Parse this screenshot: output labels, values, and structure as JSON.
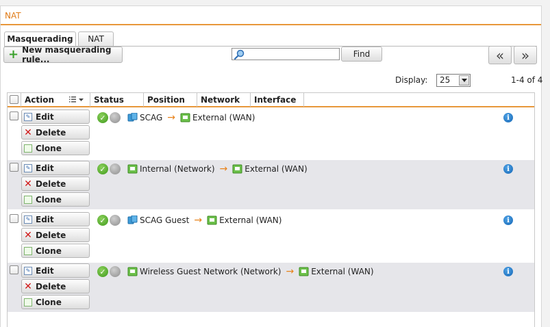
{
  "panel": {
    "title": "NAT"
  },
  "tabs": [
    {
      "label": "Masquerading",
      "active": true
    },
    {
      "label": "NAT",
      "active": false
    }
  ],
  "toolbar": {
    "new_rule_label": "New masquerading rule...",
    "search_value": "",
    "find_label": "Find",
    "prev_label": "«",
    "next_label": "»"
  },
  "display": {
    "label": "Display:",
    "value": "25",
    "count": "1-4 of 4"
  },
  "columns": [
    "Action",
    "Status",
    "Position",
    "Network",
    "Interface"
  ],
  "actions": {
    "edit": "Edit",
    "delete": "Delete",
    "clone": "Clone"
  },
  "rows": [
    {
      "source": "SCAG",
      "source_icon": "network-host-icon",
      "target": "External (WAN)",
      "status": "enabled"
    },
    {
      "source": "Internal (Network)",
      "source_icon": "network-interface-icon",
      "target": "External (WAN)",
      "status": "enabled"
    },
    {
      "source": "SCAG Guest",
      "source_icon": "network-host-icon",
      "target": "External (WAN)",
      "status": "enabled"
    },
    {
      "source": "Wireless Guest Network (Network)",
      "source_icon": "network-interface-icon",
      "target": "External (WAN)",
      "status": "enabled"
    }
  ],
  "colors": {
    "accent": "#e8973a",
    "title": "#e07b17",
    "enabled": "#3f9a1c",
    "info": "#1566b5"
  }
}
